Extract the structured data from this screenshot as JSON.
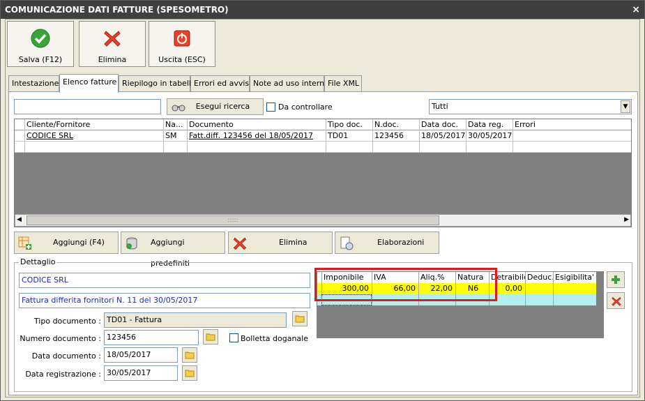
{
  "title": "COMUNICAZIONE DATI FATTURE (SPESOMETRO)",
  "close": "×",
  "toolbar": {
    "save": "Salva (F12)",
    "delete": "Elimina",
    "exit": "Uscita (ESC)"
  },
  "tabs": [
    "Intestazione",
    "Elenco fatture",
    "Riepilogo in tabella",
    "Errori ed avvisi",
    "Note ad uso interno",
    "File XML"
  ],
  "search": {
    "value": "",
    "button": "Esegui ricerca",
    "check_label": "Da controllare",
    "filter": "Tutti"
  },
  "grid": {
    "headers": [
      "Cliente/Fornitore",
      "Na...",
      "Documento",
      "Tipo doc.",
      "N.doc.",
      "Data doc.",
      "Data reg.",
      "Errori"
    ],
    "rows": [
      [
        "CODICE SRL",
        "SM",
        "Fatt.diff. 123456 del 18/05/2017",
        "TD01",
        "123456",
        "18/05/2017",
        "30/05/2017",
        ""
      ]
    ]
  },
  "scroll_grip": ":::::",
  "actions": {
    "add": "Aggiungi (F4)",
    "add_default": "Aggiungi predefiniti",
    "delete": "Elimina",
    "elab": "Elaborazioni"
  },
  "detail": {
    "legend": "Dettaglio",
    "client": "CODICE SRL",
    "desc": "Fattura differita fornitori N. 11 del 30/05/2017",
    "tipo_label": "Tipo documento :",
    "tipo_value": "TD01 - Fattura",
    "num_label": "Numero documento :",
    "num_value": "123456",
    "bolletta": "Bolletta doganale",
    "data_label": "Data documento :",
    "data_value": "18/05/2017",
    "reg_label": "Data registrazione :",
    "reg_value": "30/05/2017"
  },
  "vat": {
    "headers": [
      "Imponibile",
      "IVA",
      "Aliq.%",
      "Natura",
      "Detraibile",
      "Deduc.",
      "Esigibilita'"
    ],
    "row": [
      "300,00",
      "66,00",
      "22,00",
      "N6",
      "0,00",
      "",
      ""
    ]
  },
  "colors": {
    "title_bg": "#404040",
    "highlight": "#ffff00",
    "new_row": "#b4eef0",
    "frame_red": "#e01a1a"
  }
}
